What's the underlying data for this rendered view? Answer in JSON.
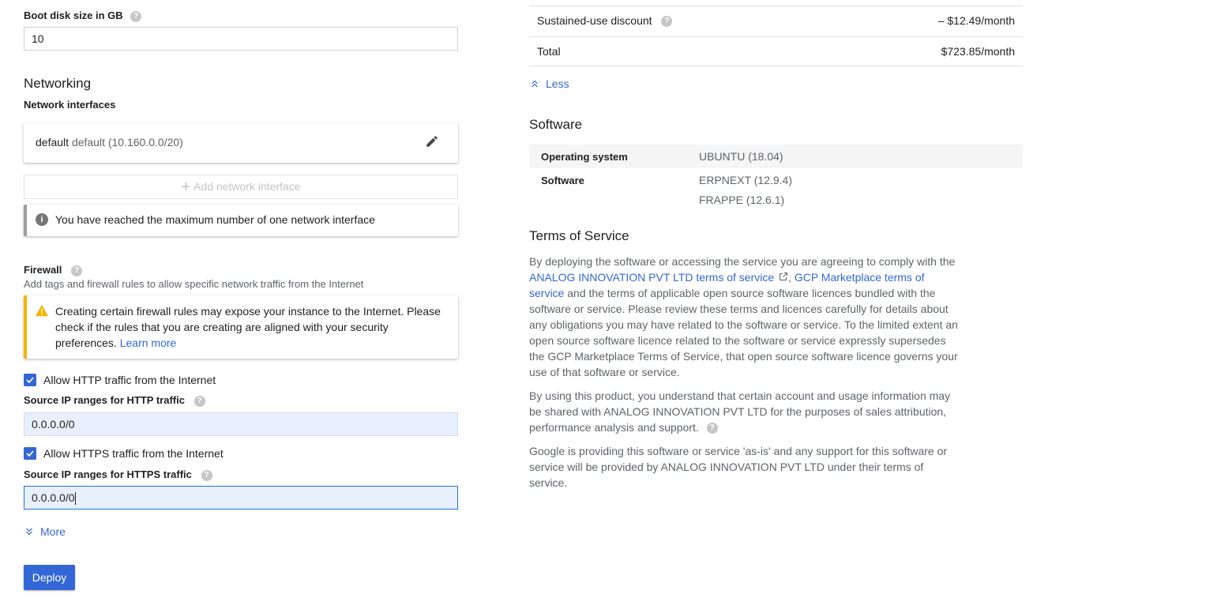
{
  "boot_disk": {
    "label": "Boot disk size in GB",
    "value": "10"
  },
  "networking": {
    "title": "Networking",
    "interfaces_label": "Network interfaces",
    "interface": {
      "name": "default",
      "detail": "default (10.160.0.0/20)"
    },
    "add_interface_label": "Add network interface",
    "max_notice": "You have reached the maximum number of one network interface"
  },
  "firewall": {
    "title": "Firewall",
    "description": "Add tags and firewall rules to allow specific network traffic from the Internet",
    "warning_text": "Creating certain firewall rules may expose your instance to the Internet. Please check if the rules that you are creating are aligned with your security preferences.",
    "warning_link": "Learn more",
    "http": {
      "checkbox_label": "Allow HTTP traffic from the Internet",
      "checked": true,
      "source_label": "Source IP ranges for HTTP traffic",
      "source_value": "0.0.0.0/0"
    },
    "https": {
      "checkbox_label": "Allow HTTPS traffic from the Internet",
      "checked": true,
      "source_label": "Source IP ranges for HTTPS traffic",
      "source_value": "0.0.0.0/0"
    }
  },
  "more_label": "More",
  "deploy_label": "Deploy",
  "pricing": {
    "discount_label": "Sustained-use discount",
    "discount_value": "– $12.49/month",
    "total_label": "Total",
    "total_value": "$723.85/month",
    "less_label": "Less"
  },
  "software_section": {
    "title": "Software",
    "os_label": "Operating system",
    "os_value": "UBUNTU (18.04)",
    "software_label": "Software",
    "software_values": [
      "ERPNEXT (12.9.4)",
      "FRAPPE (12.6.1)"
    ]
  },
  "terms": {
    "title": "Terms of Service",
    "p1_a": "By deploying the software or accessing the service you are agreeing to comply with the ",
    "p1_link1": "ANALOG INNOVATION PVT LTD terms of service",
    "p1_sep": ", ",
    "p1_link2": "GCP Marketplace terms of service",
    "p1_b": " and the terms of applicable open source software licences bundled with the software or service. Please review these terms and licences carefully for details about any obligations you may have related to the software or service. To the limited extent an open source software licence related to the software or service expressly supersedes the GCP Marketplace Terms of Service, that open source software licence governs your use of that software or service.",
    "p2": "By using this product, you understand that certain account and usage information may be shared with ANALOG INNOVATION PVT LTD for the purposes of sales attribution, performance analysis and support.",
    "p3": "Google is providing this software or service 'as-is' and any support for this software or service will be provided by ANALOG INNOVATION PVT LTD under their terms of service."
  },
  "colors": {
    "accent": "#3367d6",
    "warning": "#f4b400",
    "input_fill": "#e8f0fe"
  }
}
